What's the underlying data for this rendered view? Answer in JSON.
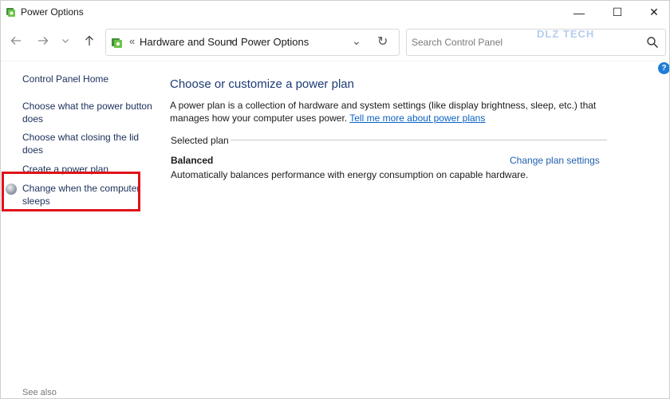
{
  "window": {
    "title": "Power Options",
    "controls": {
      "minimize": "—",
      "maximize": "☐",
      "close": "✕"
    }
  },
  "nav": {
    "back_icon": "arrow-left-icon",
    "forward_icon": "arrow-right-icon",
    "history_icon": "chevron-down-icon",
    "up_icon": "arrow-up-icon",
    "breadcrumb_overflow": "«",
    "breadcrumbs": [
      "Hardware and Sound",
      "Power Options"
    ],
    "breadcrumb_separator": "›",
    "address_dropdown": "⌄",
    "refresh": "↻",
    "search_placeholder": "Search Control Panel"
  },
  "watermark": "DLZ TECH",
  "help_label": "?",
  "sidebar": {
    "home": "Control Panel Home",
    "items": [
      {
        "label": "Choose what the power button does"
      },
      {
        "label": "Choose what closing the lid does"
      },
      {
        "label": "Create a power plan"
      },
      {
        "label": "Change when the computer sleeps"
      }
    ],
    "see_also": "See also"
  },
  "main": {
    "heading": "Choose or customize a power plan",
    "description": "A power plan is a collection of hardware and system settings (like display brightness, sleep, etc.) that manages how your computer uses power.",
    "description_link": "Tell me more about power plans",
    "selected_plan_label": "Selected plan",
    "plan": {
      "name": "Balanced",
      "description": "Automatically balances performance with energy consumption on capable hardware.",
      "settings_link": "Change plan settings"
    }
  },
  "colors": {
    "highlight_box": "#e0121a",
    "link": "#0b62c4",
    "heading": "#1c3b74"
  }
}
